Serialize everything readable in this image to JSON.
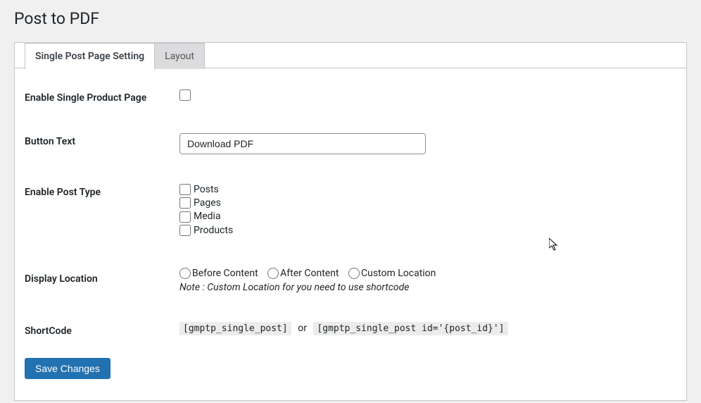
{
  "page": {
    "title": "Post to PDF"
  },
  "tabs": {
    "single_post": "Single Post Page Setting",
    "layout": "Layout"
  },
  "fields": {
    "enable_single_label": "Enable Single Product Page",
    "button_text_label": "Button Text",
    "button_text_value": "Download PDF",
    "enable_post_type_label": "Enable Post Type",
    "post_types": {
      "posts": "Posts",
      "pages": "Pages",
      "media": "Media",
      "products": "Products"
    },
    "display_location_label": "Display Location",
    "display_options": {
      "before": "Before Content",
      "after": "After Content",
      "custom": "Custom Location"
    },
    "display_note": "Note : Custom Location for you need to use shortcode",
    "shortcode_label": "ShortCode",
    "shortcode1": "[gmptp_single_post]",
    "shortcode_or": "or",
    "shortcode2": "[gmptp_single_post id='{post_id}']"
  },
  "buttons": {
    "save": "Save Changes"
  }
}
